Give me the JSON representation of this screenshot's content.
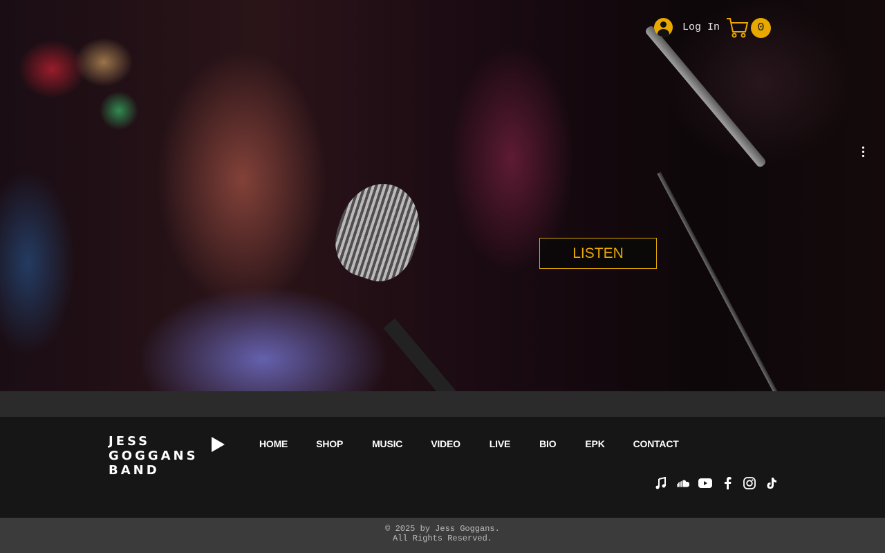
{
  "header": {
    "login_label": "Log In",
    "cart_count": "0"
  },
  "hero": {
    "cta_label": "LISTEN"
  },
  "footer": {
    "brand_line1": "JESS",
    "brand_line2": "GOGGANS",
    "brand_line3": "BAND",
    "nav": [
      "HOME",
      "SHOP",
      "MUSIC",
      "VIDEO",
      "LIVE",
      "BIO",
      "EPK",
      "CONTACT"
    ],
    "social_icons": [
      "music-note-icon",
      "soundcloud-icon",
      "youtube-icon",
      "facebook-icon",
      "instagram-icon",
      "tiktok-icon"
    ],
    "copyright_line1": "© 2025 by Jess Goggans.",
    "copyright_line2": "All Rights Reserved."
  },
  "colors": {
    "accent": "#e8a800",
    "footer_bg": "#161616",
    "strip_bg": "#2b2b2b",
    "copyright_bg": "#3b3b3b"
  }
}
